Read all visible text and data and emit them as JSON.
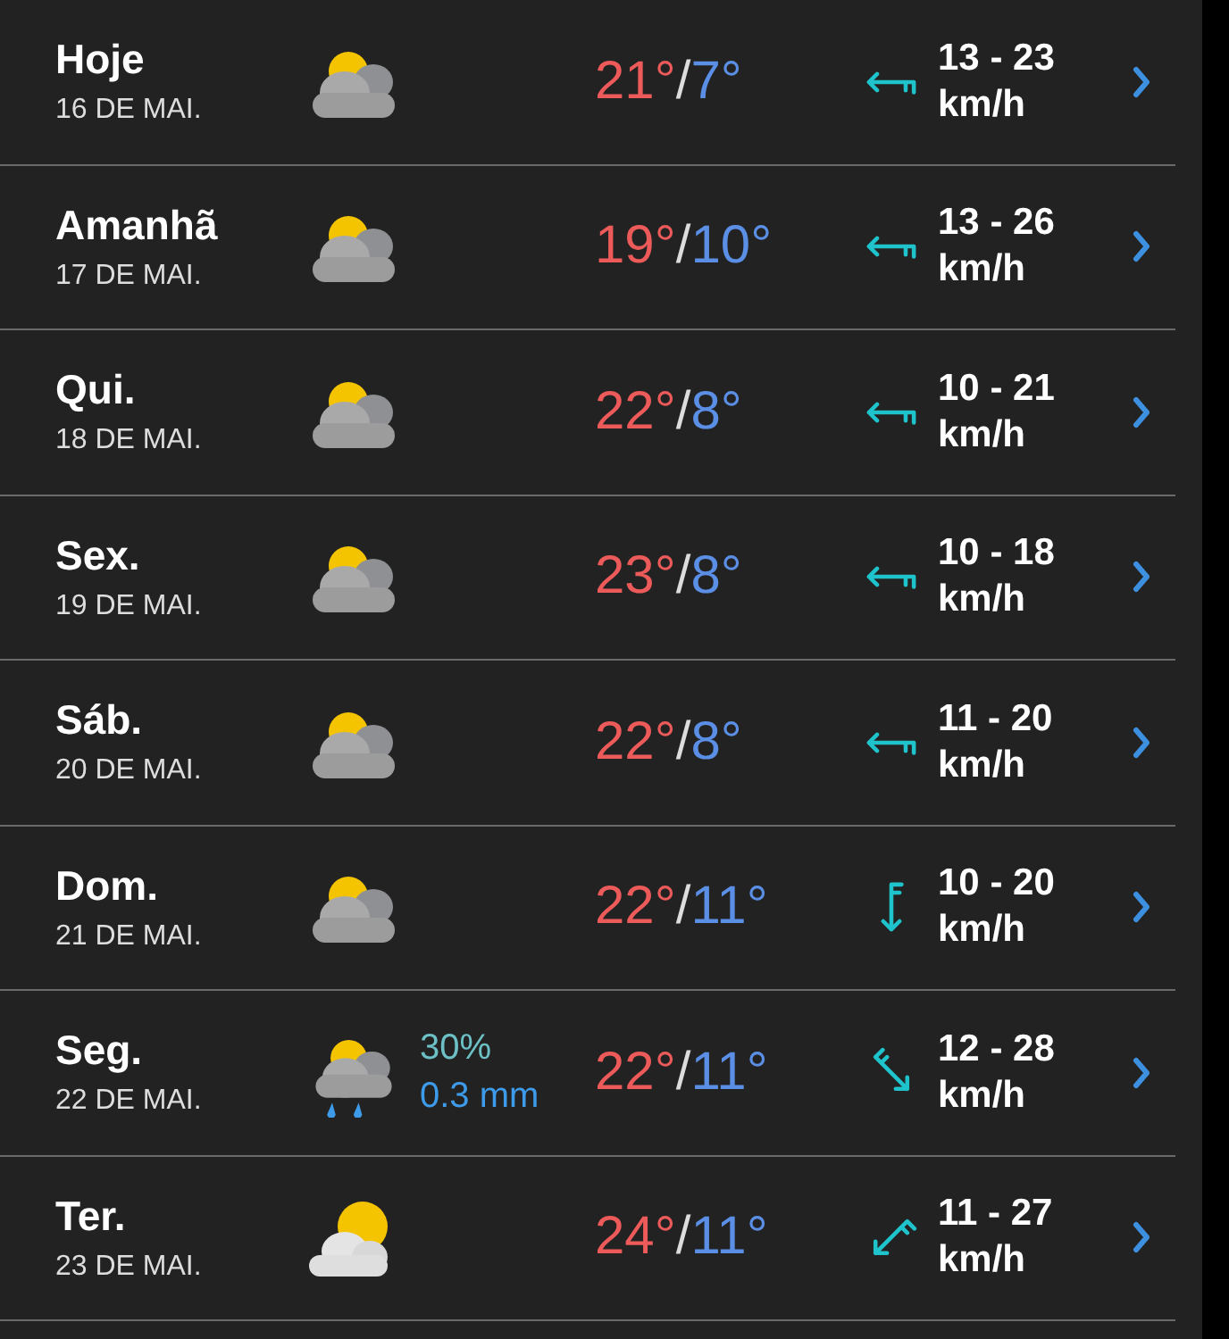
{
  "days": [
    {
      "day": "Hoje",
      "date": "16 DE MAI.",
      "weather": {
        "kind": "cloudy"
      },
      "high": "21°",
      "separator": "/",
      "low": "7°",
      "wind": {
        "kind": "west",
        "speed": "13 - 23",
        "unit": "km/h"
      }
    },
    {
      "day": "Amanhã",
      "date": "17 DE MAI.",
      "weather": {
        "kind": "cloudy"
      },
      "high": "19°",
      "separator": "/",
      "low": "10°",
      "wind": {
        "kind": "west",
        "speed": "13 - 26",
        "unit": "km/h"
      }
    },
    {
      "day": "Qui.",
      "date": "18 DE MAI.",
      "weather": {
        "kind": "cloudy"
      },
      "high": "22°",
      "separator": "/",
      "low": "8°",
      "wind": {
        "kind": "west",
        "speed": "10 - 21",
        "unit": "km/h"
      }
    },
    {
      "day": "Sex.",
      "date": "19 DE MAI.",
      "weather": {
        "kind": "cloudy"
      },
      "high": "23°",
      "separator": "/",
      "low": "8°",
      "wind": {
        "kind": "west",
        "speed": "10 - 18",
        "unit": "km/h"
      }
    },
    {
      "day": "Sáb.",
      "date": "20 DE MAI.",
      "weather": {
        "kind": "cloudy"
      },
      "high": "22°",
      "separator": "/",
      "low": "8°",
      "wind": {
        "kind": "west",
        "speed": "11 - 20",
        "unit": "km/h"
      }
    },
    {
      "day": "Dom.",
      "date": "21 DE MAI.",
      "weather": {
        "kind": "cloudy"
      },
      "high": "22°",
      "separator": "/",
      "low": "11°",
      "wind": {
        "kind": "south",
        "speed": "10 - 20",
        "unit": "km/h"
      }
    },
    {
      "day": "Seg.",
      "date": "22 DE MAI.",
      "weather": {
        "kind": "rain",
        "chance": "30%",
        "amount": "0.3 mm"
      },
      "high": "22°",
      "separator": "/",
      "low": "11°",
      "wind": {
        "kind": "southeast",
        "speed": "12 - 28",
        "unit": "km/h"
      }
    },
    {
      "day": "Ter.",
      "date": "23 DE MAI.",
      "weather": {
        "kind": "sunny"
      },
      "high": "24°",
      "separator": "/",
      "low": "11°",
      "wind": {
        "kind": "southwest",
        "speed": "11 - 27",
        "unit": "km/h"
      }
    }
  ]
}
